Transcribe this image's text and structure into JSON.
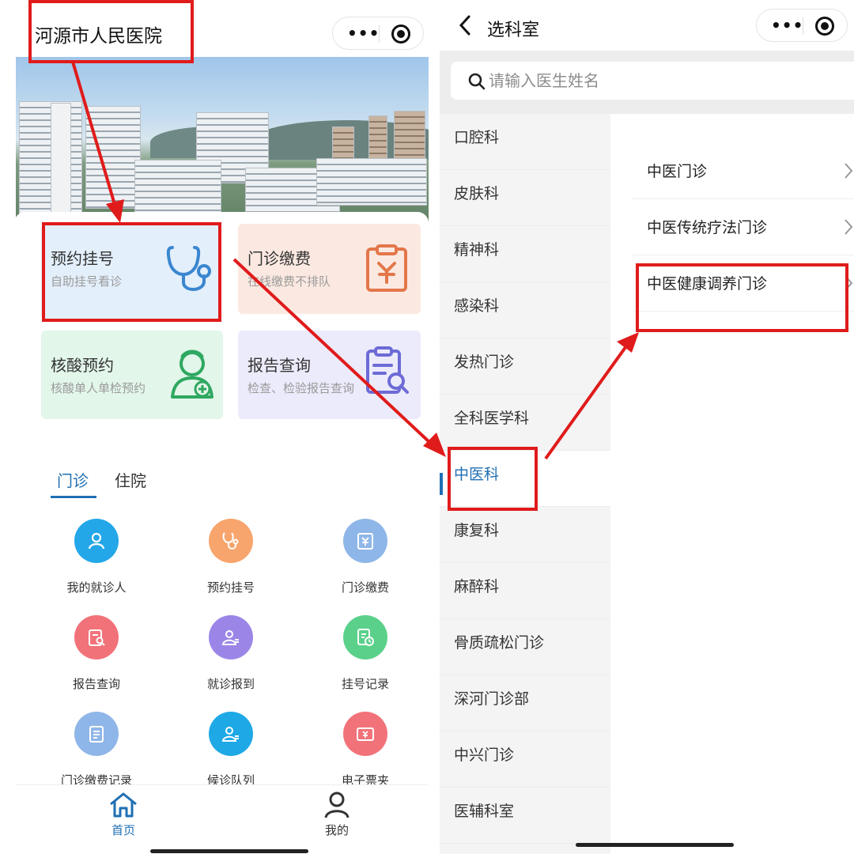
{
  "left_screen": {
    "title": "河源市人民医院",
    "banner_alt": "医院楼群",
    "cards": [
      {
        "title": "预约挂号",
        "subtitle": "自助挂号看诊",
        "icon": "stethoscope-icon",
        "bg": "#e3effb",
        "accent": "#3a86d0"
      },
      {
        "title": "门诊缴费",
        "subtitle": "在线缴费不排队",
        "icon": "invoice-yen-icon",
        "bg": "#fbe9e1",
        "accent": "#e3774a"
      },
      {
        "title": "核酸预约",
        "subtitle": "核酸单人单检预约",
        "icon": "nurse-icon",
        "bg": "#e2f6ea",
        "accent": "#2fa860"
      },
      {
        "title": "报告查询",
        "subtitle": "检查、检验报告查询",
        "icon": "report-search-icon",
        "bg": "#ecebfb",
        "accent": "#6d6bd6"
      }
    ],
    "tabs": [
      "门诊",
      "住院"
    ],
    "grid": [
      {
        "label": "我的就诊人",
        "icon": "person-icon",
        "color": "#23a7e8"
      },
      {
        "label": "预约挂号",
        "icon": "stethoscope-icon",
        "color": "#f7a56d"
      },
      {
        "label": "门诊缴费",
        "icon": "invoice-yen-icon",
        "color": "#8fb6e8"
      },
      {
        "label": "报告查询",
        "icon": "report-search-icon",
        "color": "#f2727a"
      },
      {
        "label": "就诊报到",
        "icon": "person-card-icon",
        "color": "#9b86e8"
      },
      {
        "label": "挂号记录",
        "icon": "record-clock-icon",
        "color": "#5bd08a"
      },
      {
        "label": "门诊缴费记录",
        "icon": "clipboard-icon",
        "color": "#8fb6e8"
      },
      {
        "label": "候诊队列",
        "icon": "person-card-icon",
        "color": "#1ea9e6"
      },
      {
        "label": "电子票夹",
        "icon": "ticket-yen-icon",
        "color": "#f2727a"
      }
    ],
    "tabbar": [
      {
        "label": "首页",
        "icon": "home-icon",
        "color": "#1f6fb3"
      },
      {
        "label": "我的",
        "icon": "user-icon",
        "color": "#333333"
      }
    ]
  },
  "right_screen": {
    "back_icon": "chevron-left-icon",
    "title": "选科室",
    "search_placeholder": "请输入医生姓名",
    "departments": [
      "口腔科",
      "皮肤科",
      "精神科",
      "感染科",
      "发热门诊",
      "全科医学科",
      "中医科",
      "康复科",
      "麻醉科",
      "骨质疏松门诊",
      "深河门诊部",
      "中兴门诊",
      "医辅科室"
    ],
    "active_department": "中医科",
    "sub_clinics": [
      "中医门诊",
      "中医传统疗法门诊",
      "中医健康调养门诊"
    ]
  },
  "colors": {
    "annotation": "#e01b1b",
    "primary": "#1f6fb3"
  }
}
